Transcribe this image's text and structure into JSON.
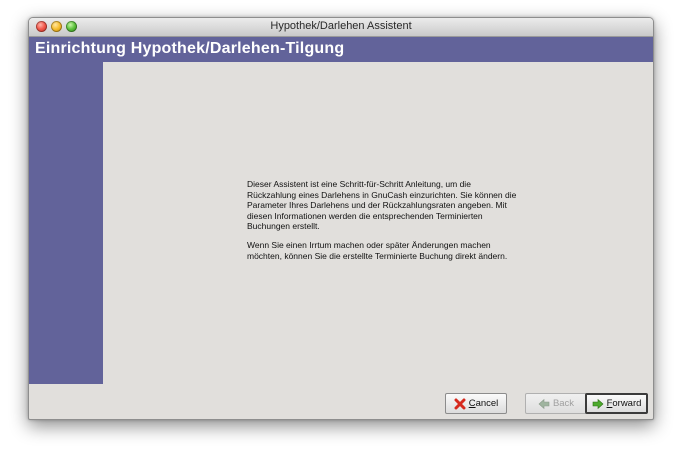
{
  "window": {
    "title": "Hypothek/Darlehen Assistent"
  },
  "page": {
    "title": "Einrichtung Hypothek/Darlehen-Tilgung",
    "paragraphs": [
      "Dieser Assistent ist eine Schritt-für-Schritt Anleitung, um die Rückzahlung eines Darlehens in GnuCash einzurichten. Sie können die Parameter Ihres Darlehens und der Rückzahlungsraten angeben. Mit diesen Informationen werden die entsprechenden Terminierten Buchungen erstellt.",
      "Wenn Sie einen Irrtum machen oder später Änderungen machen möchten, können Sie die erstellte Terminierte Buchung direkt ändern."
    ]
  },
  "buttons": {
    "cancel": {
      "first": "C",
      "rest": "ancel",
      "icon": "cancel-x-icon"
    },
    "back": {
      "first": "",
      "rest": "Back",
      "icon": "back-arrow-icon"
    },
    "forward": {
      "first": "F",
      "rest": "orward",
      "icon": "forward-arrow-icon"
    }
  },
  "colors": {
    "accent_band": "#62639a",
    "background": "#e1dfdc"
  }
}
